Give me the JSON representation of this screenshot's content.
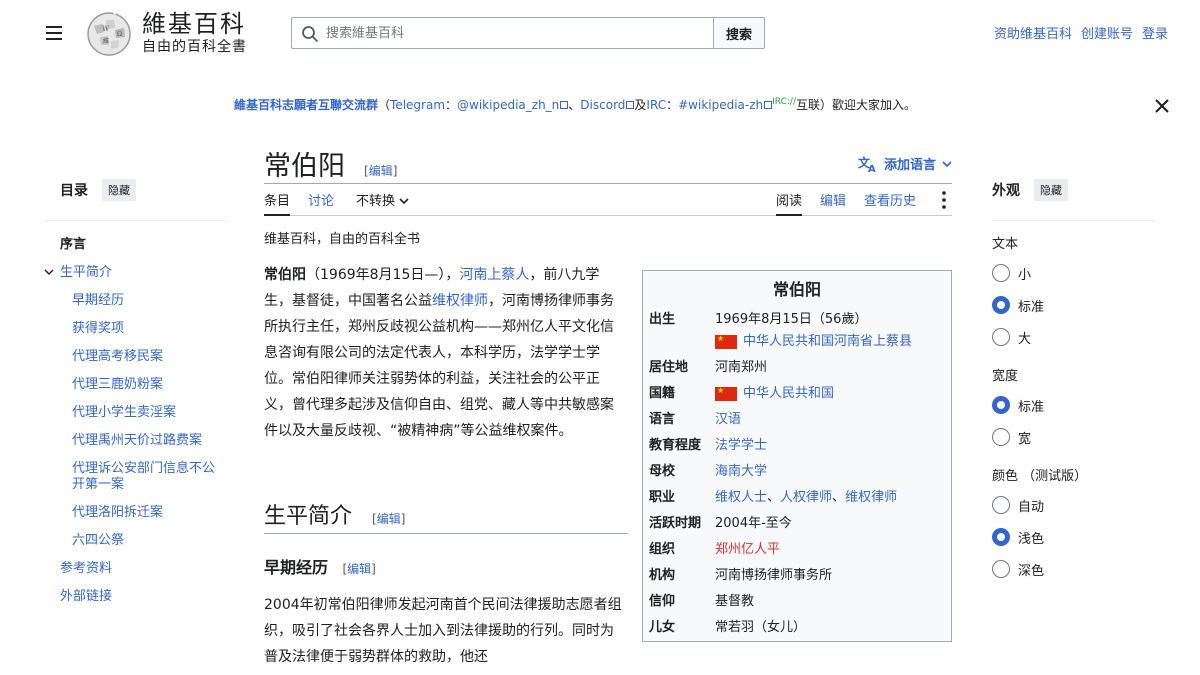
{
  "header": {
    "logo_wordmark": "維基百科",
    "logo_tagline": "自由的百科全書",
    "search_placeholder": "搜索維基百科",
    "search_button": "搜索",
    "user_links": [
      "资助维基百科",
      "创建账号",
      "登录"
    ]
  },
  "banner": {
    "link_title": "維基百科志願者互聯交流群",
    "open_paren": "（",
    "telegram": "Telegram",
    "colon": "：",
    "telegram_handle": "@wikipedia_zh_n",
    "sep": "、",
    "discord": "Discord",
    "and": "及",
    "irc": "IRC",
    "irc_channel": "#wikipedia-zh",
    "irc_sup": "IRC://",
    "tail": "互联）歡迎大家加入。"
  },
  "toc": {
    "title": "目录",
    "hide": "隐藏",
    "items": [
      {
        "label": "序言",
        "level": 1,
        "current": true
      },
      {
        "label": "生平简介",
        "level": 1,
        "expanded": true
      },
      {
        "label": "早期经历",
        "level": 2
      },
      {
        "label": "获得奖项",
        "level": 2
      },
      {
        "label": "代理高考移民案",
        "level": 2
      },
      {
        "label": "代理三鹿奶粉案",
        "level": 2
      },
      {
        "label": "代理小学生卖淫案",
        "level": 2
      },
      {
        "label": "代理禹州天价过路费案",
        "level": 2
      },
      {
        "label": "代理诉公安部门信息不公开第一案",
        "level": 2
      },
      {
        "label": "代理洛阳拆迁案",
        "level": 2
      },
      {
        "label": "六四公祭",
        "level": 2
      },
      {
        "label": "参考资料",
        "level": 1
      },
      {
        "label": "外部链接",
        "level": 1
      }
    ]
  },
  "title": {
    "text": "常伯阳",
    "edit": "编辑",
    "add_languages": "添加语言"
  },
  "tabs": {
    "article": "条目",
    "talk": "讨论",
    "variant": "不转换",
    "read": "阅读",
    "edit": "编辑",
    "history": "查看历史"
  },
  "sitesub": "维基百科，自由的百科全书",
  "lead": {
    "name": "常伯阳",
    "p1": "（1969年8月15日—），",
    "link1": "河南上蔡人",
    "p2": "，前八九学生，基督徒，中国著名公益",
    "link2": "维权律师",
    "p3": "，河南博扬律师事务所执行主任，郑州反歧视公益机构——郑州亿人平文化信息咨询有限公司的法定代表人，本科学历，法学学士学位。常伯阳律师关注弱势体的利益，关注社会的公平正义，曾代理多起涉及信仰自由、组党、藏人等中共敏感案件以及大量反歧视、“被精神病”等公益维权案件。"
  },
  "section": {
    "h2": "生平简介",
    "h3": "早期经历",
    "edit": "编辑",
    "para": "2004年初常伯阳律师发起河南首个民间法律援助志愿者组织，吸引了社会各界人士加入到法律援助的行列。同时为普及法律便于弱势群体的救助，他还"
  },
  "infobox": {
    "title": "常伯阳",
    "rows": {
      "born_label": "出生",
      "born_date": "1969年8月15日（56歲）",
      "born_place": "中华人民共和国河南省上蔡县",
      "residence_label": "居住地",
      "residence": "河南郑州",
      "nationality_label": "国籍",
      "nationality": "中华人民共和国",
      "language_label": "语言",
      "language": "汉语",
      "education_label": "教育程度",
      "education": "法学学士",
      "alma_label": "母校",
      "alma": "海南大学",
      "job_label": "职业",
      "job1": "维权人士",
      "job_sep1": "、",
      "job2": "人权律师",
      "job_sep2": "、",
      "job3": "维权律师",
      "active_label": "活跃时期",
      "active": "2004年-至今",
      "org_label": "组织",
      "org": "郑州亿人平",
      "inst_label": "机构",
      "inst": "河南博扬律师事务所",
      "faith_label": "信仰",
      "faith": "基督教",
      "child_label": "儿女",
      "child": "常若羽（女儿）"
    }
  },
  "appearance": {
    "title": "外观",
    "hide": "隐藏",
    "text_label": "文本",
    "text_options": [
      "小",
      "标准",
      "大"
    ],
    "text_selected": 1,
    "width_label": "宽度",
    "width_options": [
      "标准",
      "宽"
    ],
    "width_selected": 0,
    "color_label": "颜色 （测试版）",
    "color_options": [
      "自动",
      "浅色",
      "深色"
    ],
    "color_selected": 1
  },
  "colors": {
    "link": "#3366cc",
    "red_link": "#d73333",
    "radio_on": "#3366cc"
  }
}
